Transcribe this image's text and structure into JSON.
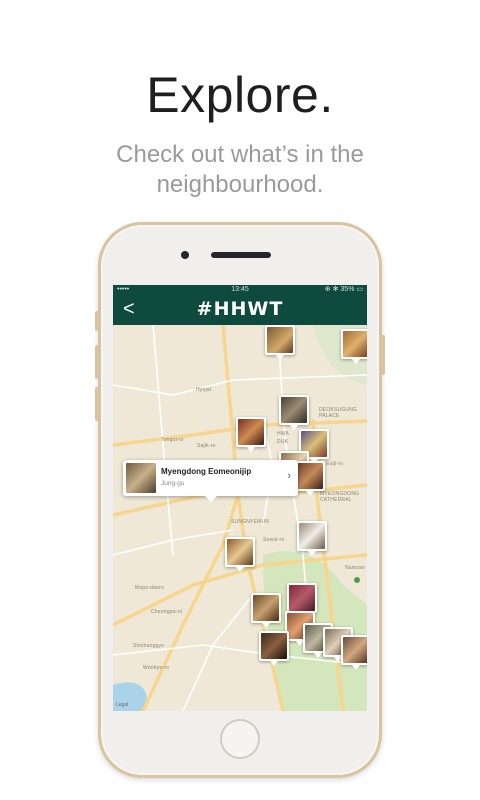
{
  "headline": "Explore.",
  "subline": [
    "Check out what’s in the",
    "neighbourhood."
  ],
  "phone": {
    "status": {
      "left": "•••••",
      "time": "13:45",
      "right": "⊕ ✻ 35% ▭"
    },
    "nav": {
      "back": "<",
      "logo": "#HHWT"
    },
    "map": {
      "labels": [
        "Hyojal",
        "Tongui-ro",
        "Sajik-ro",
        "HWA",
        "DUK",
        "DEOKSUGUNG PALACE",
        "Eulji-ro",
        "MYEONGDONG CATHEDRAL",
        "SUNGNYEMUN",
        "Sowol-ro",
        "Mapo-daero",
        "Cheongpa-ro",
        "Sinchanggyo",
        "Wonhyo-ro",
        "Namsan"
      ],
      "legal": "Legal"
    },
    "callout": {
      "title": "Myengdong Eomeonijip",
      "subtitle": "Jung-gu",
      "chevron": "›"
    }
  },
  "colors": {
    "nav": "#0e4a3e",
    "accent_gold": "#d9c3a0",
    "map_bg": "#efe8d6",
    "road": "#f7d58c",
    "park": "#cde6b5"
  }
}
